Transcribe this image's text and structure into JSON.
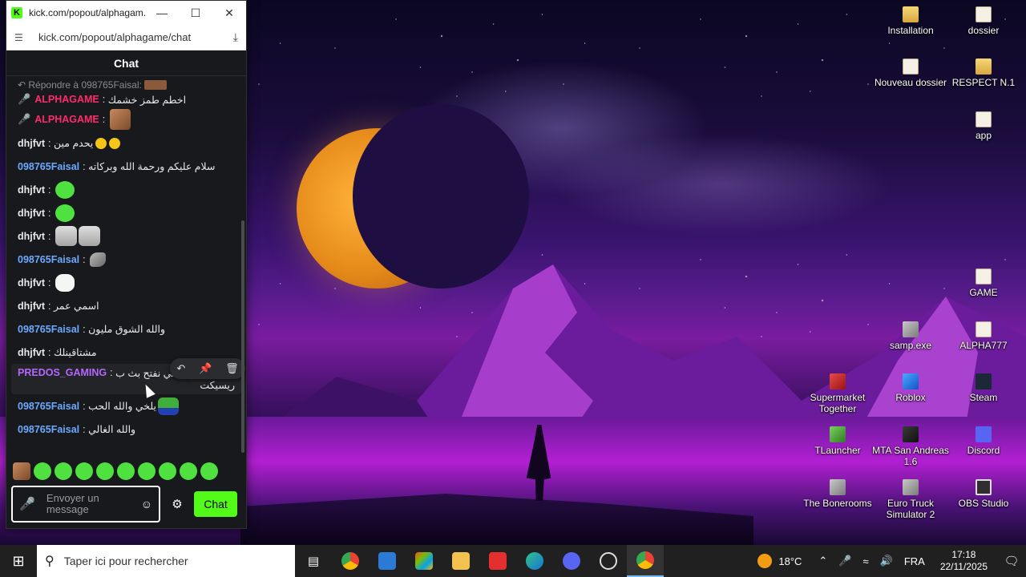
{
  "browser": {
    "title": "kick.com/popout/alphagam...",
    "url": "kick.com/popout/alphagame/chat",
    "logo_letter": "K"
  },
  "chat": {
    "header": "Chat",
    "reply_to": "Répondre à 098765Faisal:",
    "messages": [
      {
        "user": "ALPHAGAME",
        "text": "اخطم طمز خشمك"
      },
      {
        "user": "ALPHAGAME",
        "text": ""
      },
      {
        "user": "dhjfvt",
        "text": "يحدم مين"
      },
      {
        "user": "098765Faisal",
        "text": "سلام عليكم ورحمة الله وبركاته"
      },
      {
        "user": "dhjfvt",
        "text": ""
      },
      {
        "user": "dhjfvt",
        "text": ""
      },
      {
        "user": "dhjfvt",
        "text": ""
      },
      {
        "user": "098765Faisal",
        "text": ""
      },
      {
        "user": "dhjfvt",
        "text": ""
      },
      {
        "user": "dhjfvt",
        "text": "اسمي عمر"
      },
      {
        "user": "098765Faisal",
        "text": "والله الشوق مليون"
      },
      {
        "user": "dhjfvt",
        "text": "مشتاقينلك"
      },
      {
        "user": "PREDOS_GAMING",
        "text": "ولي أني نفتح بث ب",
        "text2": "ريسيكت"
      },
      {
        "user": "098765Faisal",
        "text": "يلخي والله الحب"
      },
      {
        "user": "098765Faisal",
        "text": "والله الغالي"
      }
    ],
    "input_placeholder_line1": "Envoyer un",
    "input_placeholder_line2": "message",
    "send_label": "Chat"
  },
  "desktop_icons": [
    {
      "label": "Installation"
    },
    {
      "label": "dossier"
    },
    {
      "label": "Nouveau dossier"
    },
    {
      "label": "RESPECT N.1"
    },
    {
      "label": "app"
    },
    {
      "label": "GAME"
    },
    {
      "label": "samp.exe"
    },
    {
      "label": "ALPHA777"
    },
    {
      "label": "Supermarket Together"
    },
    {
      "label": "Roblox"
    },
    {
      "label": "Steam"
    },
    {
      "label": "TLauncher"
    },
    {
      "label": "MTA San Andreas 1.6"
    },
    {
      "label": "Discord"
    },
    {
      "label": "The Bonerooms"
    },
    {
      "label": "Euro Truck Simulator 2"
    },
    {
      "label": "OBS Studio"
    }
  ],
  "taskbar": {
    "search_placeholder": "Taper ici pour rechercher",
    "temperature": "18°C",
    "language": "FRA",
    "time": "17:18",
    "date": "22/11/2025"
  },
  "colors": {
    "kick_green": "#53fc18",
    "alpha_user": "#ff2a6a",
    "faisal_user": "#6ca9ff",
    "predos_user": "#b566ff"
  }
}
